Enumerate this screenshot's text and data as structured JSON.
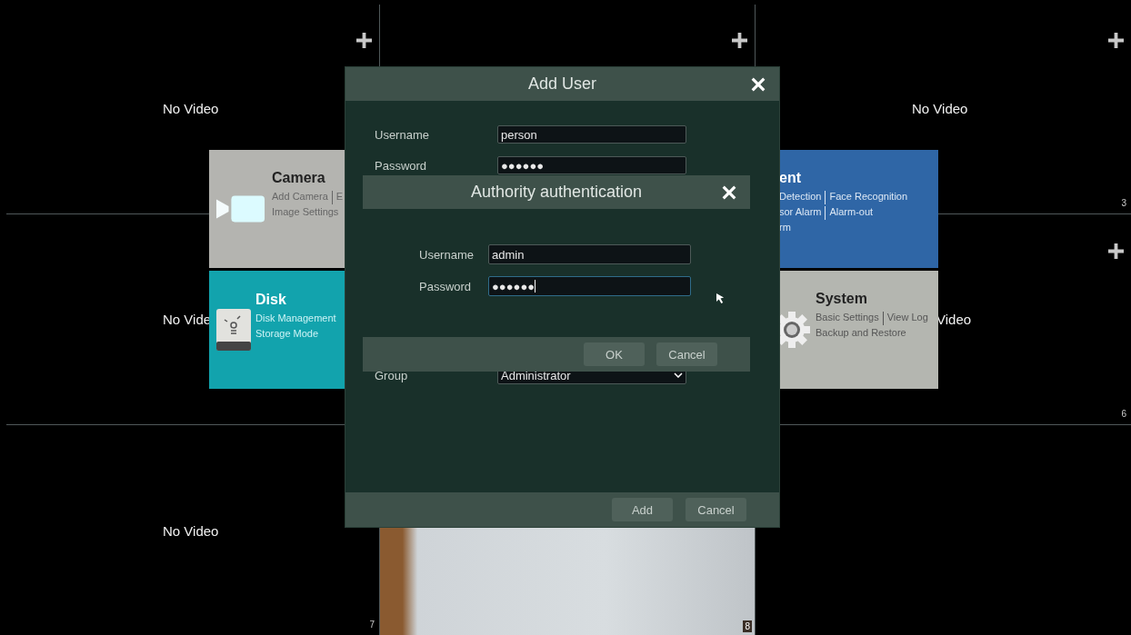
{
  "video_grid": {
    "cells": [
      {
        "label": "No Video",
        "add": true
      },
      {
        "add": true
      },
      {
        "label": "No Video",
        "add": true,
        "number": "3"
      },
      {
        "label": "No Vide"
      },
      {},
      {
        "label": "Video",
        "add": true,
        "number": "6"
      },
      {
        "label": "No Video",
        "number": "7"
      },
      {
        "photo": true,
        "number": "8"
      },
      {}
    ]
  },
  "menu_tiles": [
    {
      "kind": "camera",
      "title": "Camera",
      "color": "#b4b4b0",
      "lines": [
        [
          "Add Camera",
          "E"
        ],
        [
          "Image Settings"
        ]
      ]
    },
    {
      "kind": "event",
      "title": "ent",
      "color": "#2f66a6",
      "lines": [
        [
          "Detection",
          "Face Recognition"
        ],
        [
          "sor Alarm",
          "Alarm-out"
        ],
        [
          "rm"
        ]
      ]
    },
    {
      "kind": "disk",
      "title": "Disk",
      "color": "#12a3ad",
      "lines": [
        [
          "Disk Management"
        ],
        [
          "Storage Mode"
        ]
      ]
    },
    {
      "kind": "system",
      "title": "System",
      "color": "#b4b6b0",
      "lines": [
        [
          "Basic Settings",
          "View Log"
        ],
        [
          "Backup and Restore"
        ]
      ]
    }
  ],
  "add_user_dialog": {
    "title": "Add User",
    "fields": [
      {
        "label": "Username",
        "value": "person",
        "kind": "text"
      },
      {
        "label": "Password",
        "value": "●●●●●●",
        "kind": "text"
      },
      {
        "label": "Group",
        "value": "Administrator",
        "kind": "select"
      }
    ],
    "buttons": [
      "Add",
      "Cancel"
    ]
  },
  "auth_dialog": {
    "title": "Authority authentication",
    "fields": [
      {
        "label": "Username",
        "value": "admin",
        "focused": false
      },
      {
        "label": "Password",
        "value": "●●●●●●",
        "focused": true
      }
    ],
    "buttons": [
      "OK",
      "Cancel"
    ]
  }
}
